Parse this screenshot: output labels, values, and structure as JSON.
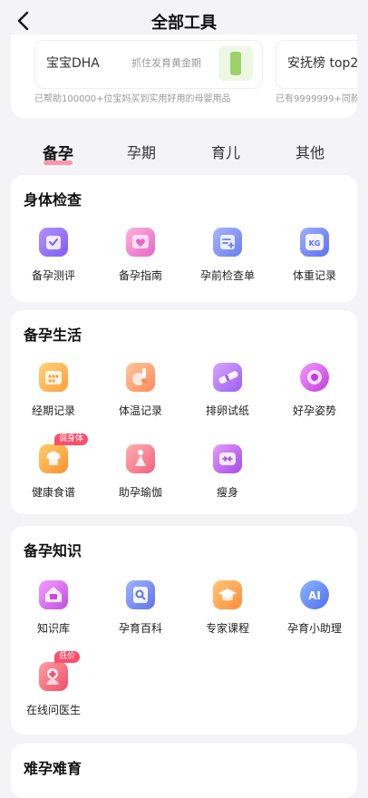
{
  "header": {
    "title": "全部工具"
  },
  "promo": {
    "items": [
      {
        "name": "宝宝DHA",
        "sub": "抓住发育黄金期",
        "note": "已帮助100000+位宝妈买到实用好用的母婴用品"
      },
      {
        "name": "安抚榜 top2",
        "note": "已有9999999+同款"
      }
    ]
  },
  "tabs": [
    {
      "label": "备孕",
      "active": true
    },
    {
      "label": "孕期"
    },
    {
      "label": "育儿"
    },
    {
      "label": "其他"
    }
  ],
  "sections": [
    {
      "title": "身体检查",
      "tools": [
        {
          "label": "备孕测评",
          "icon": "clipboard-check-icon"
        },
        {
          "label": "备孕指南",
          "icon": "heart-book-icon"
        },
        {
          "label": "孕前检查单",
          "icon": "checklist-icon"
        },
        {
          "label": "体重记录",
          "icon": "scale-kg-icon"
        }
      ]
    },
    {
      "title": "备孕生活",
      "tools": [
        {
          "label": "经期记录",
          "icon": "calendar-icon"
        },
        {
          "label": "体温记录",
          "icon": "thermometer-icon"
        },
        {
          "label": "排卵试纸",
          "icon": "test-strip-icon"
        },
        {
          "label": "好孕姿势",
          "icon": "posture-icon"
        },
        {
          "label": "健康食谱",
          "icon": "chef-hat-icon",
          "badge": "调身体"
        },
        {
          "label": "助孕瑜伽",
          "icon": "yoga-icon"
        },
        {
          "label": "瘦身",
          "icon": "slim-icon"
        }
      ]
    },
    {
      "title": "备孕知识",
      "tools": [
        {
          "label": "知识库",
          "icon": "book-house-icon"
        },
        {
          "label": "孕育百科",
          "icon": "encyclopedia-icon"
        },
        {
          "label": "专家课程",
          "icon": "graduation-cap-icon"
        },
        {
          "label": "孕育小助理",
          "icon": "ai-assistant-icon"
        },
        {
          "label": "在线问医生",
          "icon": "doctor-icon",
          "badge": "低价"
        }
      ]
    },
    {
      "title": "难孕难育"
    }
  ]
}
